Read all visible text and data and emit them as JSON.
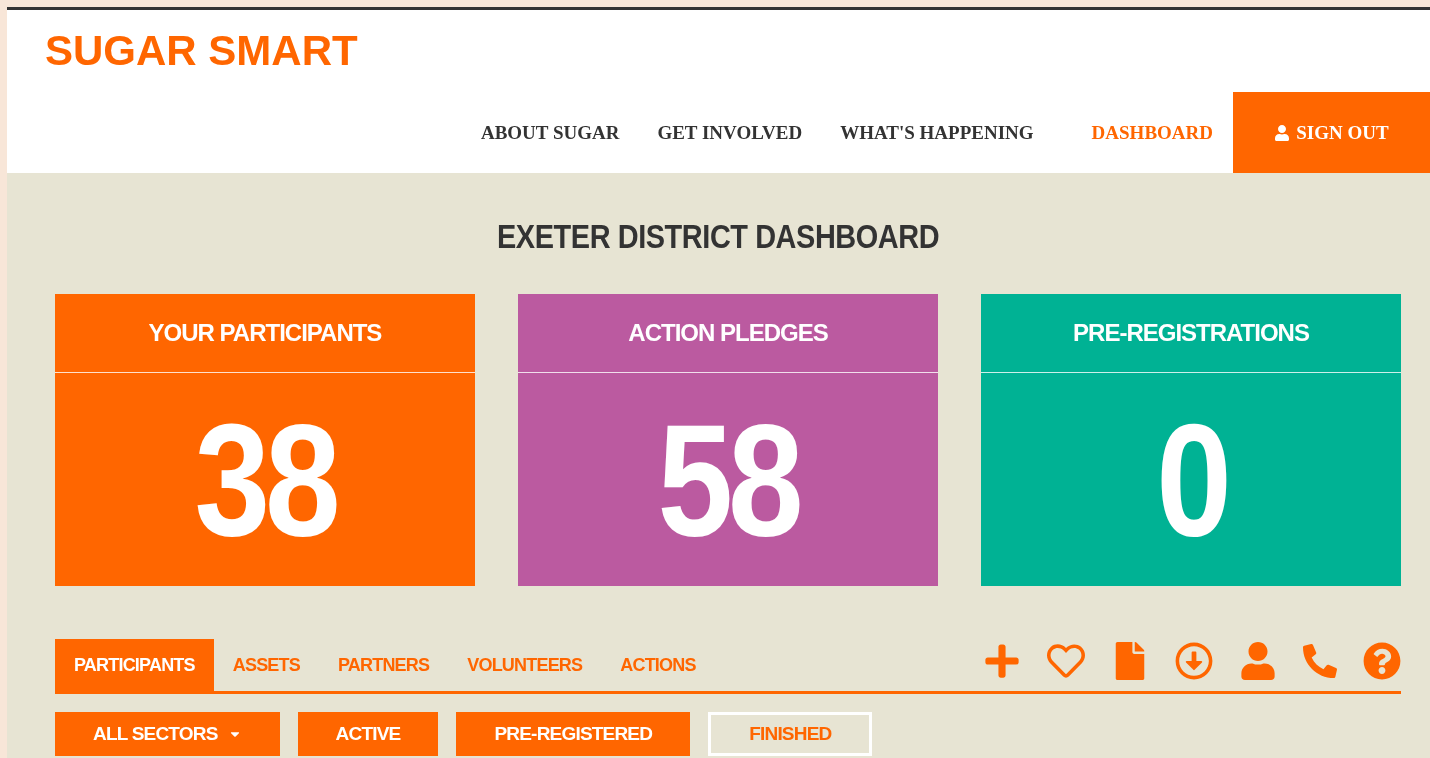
{
  "logo": "SUGAR SMART",
  "nav": [
    {
      "label": "ABOUT SUGAR",
      "selected": false
    },
    {
      "label": "GET INVOLVED",
      "selected": false
    },
    {
      "label": "WHAT'S HAPPENING",
      "selected": false
    },
    {
      "label": "DASHBOARD",
      "selected": true
    }
  ],
  "sign_out": "SIGN OUT",
  "title": "EXETER DISTRICT DASHBOARD",
  "stats": [
    {
      "label": "YOUR PARTICIPANTS",
      "value": "38",
      "color": "#ff6600"
    },
    {
      "label": "ACTION PLEDGES",
      "value": "58",
      "color": "#bb5aa0"
    },
    {
      "label": "PRE-REGISTRATIONS",
      "value": "0",
      "color": "#00b294"
    }
  ],
  "tabs": [
    {
      "label": "PARTICIPANTS",
      "selected": true
    },
    {
      "label": "ASSETS",
      "selected": false
    },
    {
      "label": "PARTNERS",
      "selected": false
    },
    {
      "label": "VOLUNTEERS",
      "selected": false
    },
    {
      "label": "ACTIONS",
      "selected": false
    }
  ],
  "tools": [
    {
      "kind": "add"
    },
    {
      "kind": "heart"
    },
    {
      "kind": "file"
    },
    {
      "kind": "download"
    },
    {
      "kind": "user"
    },
    {
      "kind": "phone"
    },
    {
      "kind": "help"
    }
  ],
  "filters": [
    {
      "label": "ALL SECTORS",
      "kind": "dropdown",
      "selected": true
    },
    {
      "label": "ACTIVE",
      "kind": "button",
      "selected": true
    },
    {
      "label": "PRE-REGISTERED",
      "kind": "button",
      "selected": true
    },
    {
      "label": "FINISHED",
      "kind": "button",
      "selected": false
    }
  ]
}
